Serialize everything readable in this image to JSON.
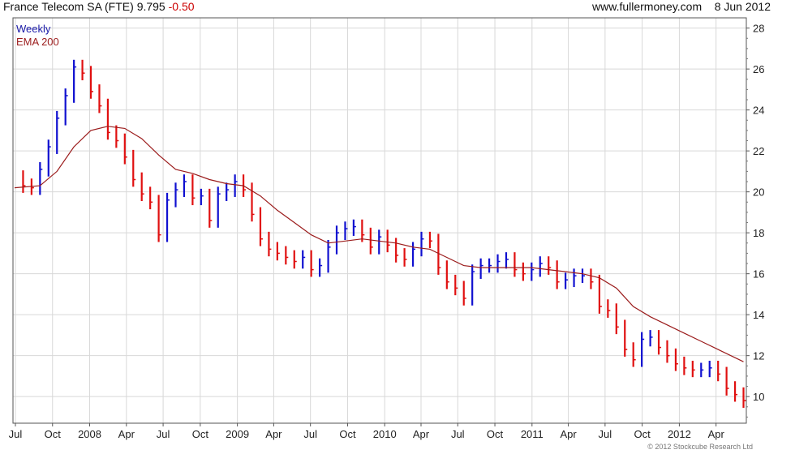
{
  "header": {
    "name": "France Telecom SA (FTE)",
    "price": "9.795",
    "change": "-0.50",
    "source": "www.fullermoney.com",
    "date": "8 Jun 2012"
  },
  "legend": [
    {
      "label": "Weekly",
      "color": "#1a1aa8"
    },
    {
      "label": "EMA 200",
      "color": "#9b1c1c"
    }
  ],
  "footer": "© 2012 Stockcube Research Ltd",
  "colors": {
    "up": "#1010d0",
    "down": "#e01010",
    "ema": "#9b1c1c",
    "grid": "#d8d8d8"
  },
  "chart_data": {
    "type": "line",
    "ylim": [
      8.7,
      28.5
    ],
    "yticks": [
      10,
      12,
      14,
      16,
      18,
      20,
      22,
      24,
      26,
      28
    ],
    "xlim": [
      "2007-06-25",
      "2012-06-15"
    ],
    "xticks": [
      {
        "label": "Jul",
        "date": "2007-07-01"
      },
      {
        "label": "Oct",
        "date": "2007-10-01"
      },
      {
        "label": "2008",
        "date": "2008-01-01"
      },
      {
        "label": "Apr",
        "date": "2008-04-01"
      },
      {
        "label": "Jul",
        "date": "2008-07-01"
      },
      {
        "label": "Oct",
        "date": "2008-10-01"
      },
      {
        "label": "2009",
        "date": "2009-01-01"
      },
      {
        "label": "Apr",
        "date": "2009-04-01"
      },
      {
        "label": "Jul",
        "date": "2009-07-01"
      },
      {
        "label": "Oct",
        "date": "2009-10-01"
      },
      {
        "label": "2010",
        "date": "2010-01-01"
      },
      {
        "label": "Apr",
        "date": "2010-04-01"
      },
      {
        "label": "Jul",
        "date": "2010-07-01"
      },
      {
        "label": "Oct",
        "date": "2010-10-01"
      },
      {
        "label": "2011",
        "date": "2011-01-01"
      },
      {
        "label": "Apr",
        "date": "2011-04-01"
      },
      {
        "label": "Jul",
        "date": "2011-07-01"
      },
      {
        "label": "Oct",
        "date": "2011-10-01"
      },
      {
        "label": "2012",
        "date": "2012-01-01"
      },
      {
        "label": "Apr",
        "date": "2012-04-01"
      }
    ],
    "series": [
      {
        "name": "Weekly",
        "style": "ohlc-bars",
        "points": [
          [
            "2007-06-29",
            20.7
          ],
          [
            "2007-07-20",
            20.3
          ],
          [
            "2007-08-10",
            20.2
          ],
          [
            "2007-08-31",
            21.1
          ],
          [
            "2007-09-21",
            22.2
          ],
          [
            "2007-10-12",
            23.6
          ],
          [
            "2007-11-02",
            24.7
          ],
          [
            "2007-11-23",
            26.1
          ],
          [
            "2007-12-14",
            25.8
          ],
          [
            "2008-01-04",
            24.9
          ],
          [
            "2008-01-25",
            24.2
          ],
          [
            "2008-02-15",
            22.9
          ],
          [
            "2008-03-07",
            22.5
          ],
          [
            "2008-03-28",
            21.7
          ],
          [
            "2008-04-18",
            20.6
          ],
          [
            "2008-05-09",
            19.9
          ],
          [
            "2008-05-30",
            19.5
          ],
          [
            "2008-06-20",
            17.9
          ],
          [
            "2008-07-11",
            19.6
          ],
          [
            "2008-08-01",
            20.1
          ],
          [
            "2008-08-22",
            20.5
          ],
          [
            "2008-09-12",
            19.7
          ],
          [
            "2008-10-03",
            19.8
          ],
          [
            "2008-10-24",
            18.6
          ],
          [
            "2008-11-14",
            19.9
          ],
          [
            "2008-12-05",
            20.1
          ],
          [
            "2008-12-26",
            20.5
          ],
          [
            "2009-01-16",
            20.1
          ],
          [
            "2009-02-06",
            18.9
          ],
          [
            "2009-02-27",
            17.7
          ],
          [
            "2009-03-20",
            17.2
          ],
          [
            "2009-04-10",
            17.0
          ],
          [
            "2009-05-01",
            16.8
          ],
          [
            "2009-05-22",
            16.6
          ],
          [
            "2009-06-12",
            16.8
          ],
          [
            "2009-07-03",
            16.2
          ],
          [
            "2009-07-24",
            16.4
          ],
          [
            "2009-08-14",
            17.3
          ],
          [
            "2009-09-04",
            18.0
          ],
          [
            "2009-09-25",
            18.2
          ],
          [
            "2009-10-16",
            18.3
          ],
          [
            "2009-11-06",
            17.9
          ],
          [
            "2009-11-27",
            17.3
          ],
          [
            "2009-12-18",
            17.8
          ],
          [
            "2010-01-08",
            17.4
          ],
          [
            "2010-01-29",
            16.9
          ],
          [
            "2010-02-19",
            16.7
          ],
          [
            "2010-03-12",
            17.2
          ],
          [
            "2010-04-02",
            17.7
          ],
          [
            "2010-04-23",
            17.6
          ],
          [
            "2010-05-14",
            16.3
          ],
          [
            "2010-06-04",
            15.6
          ],
          [
            "2010-06-25",
            15.3
          ],
          [
            "2010-07-16",
            14.8
          ],
          [
            "2010-08-06",
            16.1
          ],
          [
            "2010-08-27",
            16.4
          ],
          [
            "2010-09-17",
            16.4
          ],
          [
            "2010-10-08",
            16.6
          ],
          [
            "2010-10-29",
            16.7
          ],
          [
            "2010-11-19",
            16.2
          ],
          [
            "2010-12-10",
            16.0
          ],
          [
            "2010-12-31",
            16.2
          ],
          [
            "2011-01-21",
            16.5
          ],
          [
            "2011-02-11",
            16.3
          ],
          [
            "2011-03-04",
            15.6
          ],
          [
            "2011-03-25",
            15.7
          ],
          [
            "2011-04-15",
            15.9
          ],
          [
            "2011-05-06",
            15.9
          ],
          [
            "2011-05-27",
            15.6
          ],
          [
            "2011-06-17",
            14.4
          ],
          [
            "2011-07-08",
            14.2
          ],
          [
            "2011-07-29",
            13.4
          ],
          [
            "2011-08-19",
            12.3
          ],
          [
            "2011-09-09",
            11.8
          ],
          [
            "2011-09-30",
            12.8
          ],
          [
            "2011-10-21",
            12.9
          ],
          [
            "2011-11-11",
            12.4
          ],
          [
            "2011-12-02",
            12.0
          ],
          [
            "2011-12-23",
            11.6
          ],
          [
            "2012-01-13",
            11.4
          ],
          [
            "2012-02-03",
            11.3
          ],
          [
            "2012-02-24",
            11.3
          ],
          [
            "2012-03-16",
            11.4
          ],
          [
            "2012-04-06",
            11.1
          ],
          [
            "2012-04-27",
            10.4
          ],
          [
            "2012-05-18",
            10.1
          ],
          [
            "2012-06-08",
            9.8
          ]
        ]
      },
      {
        "name": "EMA 200",
        "style": "line",
        "points": [
          [
            "2007-06-29",
            20.2
          ],
          [
            "2007-08-31",
            20.3
          ],
          [
            "2007-10-12",
            21.0
          ],
          [
            "2007-11-23",
            22.2
          ],
          [
            "2008-01-04",
            23.0
          ],
          [
            "2008-02-15",
            23.2
          ],
          [
            "2008-03-28",
            23.1
          ],
          [
            "2008-05-09",
            22.6
          ],
          [
            "2008-06-20",
            21.8
          ],
          [
            "2008-08-01",
            21.1
          ],
          [
            "2008-09-12",
            20.9
          ],
          [
            "2008-10-24",
            20.6
          ],
          [
            "2008-12-05",
            20.4
          ],
          [
            "2009-01-16",
            20.3
          ],
          [
            "2009-02-27",
            19.8
          ],
          [
            "2009-04-10",
            19.1
          ],
          [
            "2009-05-22",
            18.5
          ],
          [
            "2009-07-03",
            17.9
          ],
          [
            "2009-08-14",
            17.5
          ],
          [
            "2009-09-25",
            17.6
          ],
          [
            "2009-11-06",
            17.7
          ],
          [
            "2009-12-18",
            17.6
          ],
          [
            "2010-01-29",
            17.5
          ],
          [
            "2010-03-12",
            17.3
          ],
          [
            "2010-04-23",
            17.2
          ],
          [
            "2010-06-04",
            16.8
          ],
          [
            "2010-07-16",
            16.4
          ],
          [
            "2010-08-27",
            16.3
          ],
          [
            "2010-10-08",
            16.3
          ],
          [
            "2010-11-19",
            16.3
          ],
          [
            "2010-12-31",
            16.3
          ],
          [
            "2011-02-11",
            16.2
          ],
          [
            "2011-03-25",
            16.1
          ],
          [
            "2011-05-06",
            16.0
          ],
          [
            "2011-06-17",
            15.8
          ],
          [
            "2011-07-29",
            15.3
          ],
          [
            "2011-09-09",
            14.4
          ],
          [
            "2011-10-21",
            13.9
          ],
          [
            "2011-12-02",
            13.5
          ],
          [
            "2012-01-13",
            13.1
          ],
          [
            "2012-02-24",
            12.7
          ],
          [
            "2012-04-06",
            12.3
          ],
          [
            "2012-05-18",
            11.9
          ],
          [
            "2012-06-08",
            11.7
          ]
        ]
      }
    ]
  }
}
